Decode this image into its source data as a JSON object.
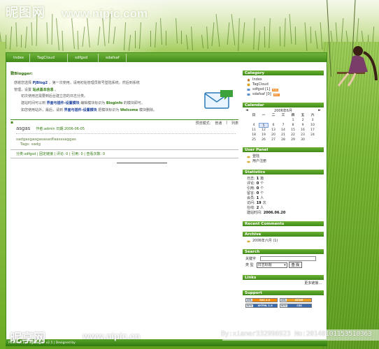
{
  "watermark": {
    "site_name": "昵图网",
    "site_url": "www.nipic.com",
    "bottom_logo": "昵享网",
    "bottom_url": "www.nipic.cn",
    "id_text": "By:xianer332996923 No:20140101153510363"
  },
  "nav": {
    "tabs": [
      "Index",
      "TagCloud",
      "sdfgsd",
      "sdafsaf"
    ]
  },
  "welcome": {
    "title": "致Blogger:",
    "line1_a": "感谢您选择",
    "line1_brand": "PJBlog2",
    "line1_b": "，第一次使用，请用初始管理员账号登陆系统，然后到系统",
    "line2_a": "管理，设置",
    "line2_link": "站点基本信息",
    "line2_b": "。",
    "line3": "初次使用还需要到后台建立您的日志分类。",
    "line4_a": "建站时间可以到",
    "line4_link": "界面与插件-设置模块",
    "line4_b": "编辑模块标识为",
    "line4_tag": "Bloginfo",
    "line4_c": "的模块即可。",
    "line5_a": "如您使用站外，最后，请到",
    "line5_link": "界面与插件-设置模块",
    "line5_b": "把模块标识为",
    "line5_tag": "Welcome",
    "line5_c": "模块删除。"
  },
  "post_bar": {
    "view_mode": "预览模式:",
    "normal": "普通",
    "list": "列表"
  },
  "post": {
    "title": "asgas",
    "meta": "作者:admin 日期:2006-06-05",
    "body": "sadgasgasgasasadfaasssaggas",
    "tags": "Tags: sadg",
    "footer": "分类:sdfgsd | 固定链接 | 评论: 0 | 引用: 0 | 查看次数: 0"
  },
  "sidebar": {
    "category": {
      "title": "Category",
      "items": [
        "Index",
        "TagCloud",
        "sdfgsd [1]",
        "sdafsaf [0]"
      ],
      "rss": "RSS"
    },
    "calendar": {
      "title": "Calendar",
      "prev": "◄",
      "month": "2006年6月",
      "next": "►",
      "weekdays": [
        "日",
        "一",
        "二",
        "三",
        "四",
        "五",
        "六"
      ],
      "days": [
        "",
        "",
        "",
        "",
        "1",
        "2",
        "3",
        "4",
        "5",
        "6",
        "7",
        "8",
        "9",
        "10",
        "11",
        "12",
        "13",
        "14",
        "15",
        "16",
        "17",
        "18",
        "19",
        "20",
        "21",
        "22",
        "23",
        "24",
        "25",
        "26",
        "27",
        "28",
        "29",
        "30",
        ""
      ],
      "today": "5"
    },
    "user_panel": {
      "title": "User Panel",
      "items": [
        "登陆",
        "用户注册"
      ]
    },
    "statistics": {
      "title": "Statistics",
      "rows": [
        {
          "label": "日志:",
          "value": "1",
          "unit": "篇"
        },
        {
          "label": "评论:",
          "value": "0",
          "unit": "个"
        },
        {
          "label": "引用:",
          "value": "0",
          "unit": "个"
        },
        {
          "label": "留言:",
          "value": "0",
          "unit": "个"
        },
        {
          "label": "会员:",
          "value": "1",
          "unit": "人"
        },
        {
          "label": "访问:",
          "value": "19",
          "unit": "次"
        },
        {
          "label": "在线:",
          "value": "2",
          "unit": "人"
        },
        {
          "label": "建站时间:",
          "value": "2006.06.20",
          "unit": ""
        }
      ]
    },
    "recent_comments": {
      "title": "Recent Comments"
    },
    "archive": {
      "title": "Archive",
      "items": [
        "2006年六月 (1)"
      ]
    },
    "search": {
      "title": "Search",
      "keyword_label": "关键字",
      "type_label": "类 型",
      "select_value": "日志标题",
      "button": "查 找"
    },
    "links": {
      "title": "Links",
      "more": "更多链接..."
    },
    "support": {
      "title": "Support",
      "badges": [
        {
          "left": "XML",
          "right": "RSS 2.0",
          "color": "#ff8c00"
        },
        {
          "left": "XML",
          "right": "ATOM",
          "color": "#f0a020"
        },
        {
          "left": "W3C",
          "right": "XHTML 1.0",
          "color": "#3a6ab0"
        },
        {
          "left": "W3C",
          "right": "CSS",
          "color": "#3a6ab0"
        }
      ]
    }
  },
  "footer": {
    "text": "Powered by",
    "brand": "PJBlog2",
    "rest": "v2.5 | Designed by"
  },
  "colors": {
    "accent": "#3f8a18",
    "link": "#2f7a10",
    "rss": "#f08a24"
  }
}
